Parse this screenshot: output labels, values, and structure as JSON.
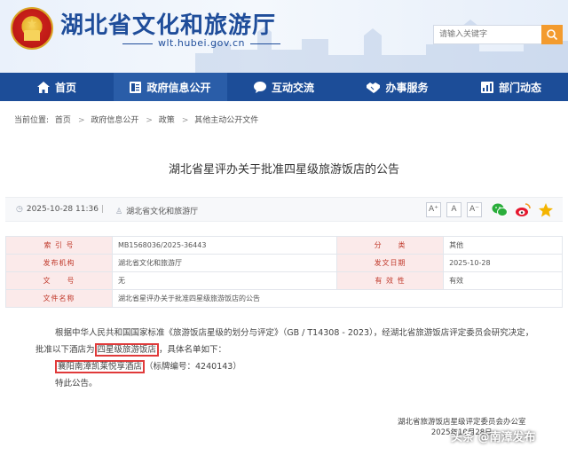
{
  "header": {
    "site_title": "湖北省文化和旅游厅",
    "site_url": "wlt.hubei.gov.cn",
    "search_placeholder": "请输入关键字"
  },
  "nav": [
    {
      "label": "首页",
      "icon": "home-icon"
    },
    {
      "label": "政府信息公开",
      "icon": "document-icon",
      "active": true
    },
    {
      "label": "互动交流",
      "icon": "chat-icon"
    },
    {
      "label": "办事服务",
      "icon": "handshake-icon"
    },
    {
      "label": "部门动态",
      "icon": "chart-icon"
    }
  ],
  "breadcrumb": {
    "prefix": "当前位置:",
    "items": [
      "首页",
      "政府信息公开",
      "政策",
      "其他主动公开文件"
    ]
  },
  "article": {
    "title": "湖北省星评办关于批准四星级旅游饭店的公告",
    "date": "2025-10-28 11:36",
    "divider": "|",
    "source": "湖北省文化和旅游厅",
    "font_buttons": [
      "A⁺",
      "A",
      "A⁻"
    ]
  },
  "info": {
    "rows": [
      {
        "k1": "索 引 号",
        "v1": "MB1568036/2025-36443",
        "k2": "分　　类",
        "v2": "其他"
      },
      {
        "k1": "发布机构",
        "v1": "湖北省文化和旅游厅",
        "k2": "发文日期",
        "v2": "2025-10-28"
      },
      {
        "k1": "文　　号",
        "v1": "无",
        "k2": "有 效 性",
        "v2": "有效"
      }
    ],
    "name_label": "文件名称",
    "name_value": "湖北省星评办关于批准四星级旅游饭店的公告"
  },
  "body": {
    "p1_a": "根据中华人民共和国国家标准《旅游饭店星级的划分与评定》（GB / T14308 - 2023），经湖北省旅游饭店评定委员会研究决定，批准以下酒店为",
    "p1_highlight": "四星级旅游饭店",
    "p1_b": "，具体名单如下：",
    "hotel": "襄阳南漳凯莱悦享酒店",
    "hotel_code": "（标牌编号：4240143）",
    "closing": "特此公告。"
  },
  "signature": {
    "org": "湖北省旅游饭店星级评定委员会办公室",
    "date": "2025年10月28日"
  },
  "watermark": "头条 @南漳发布",
  "colors": {
    "nav_bg": "#1c4d98",
    "title_blue": "#1f4d9a",
    "label_red": "#c0392b",
    "highlight_border": "#e03a3a",
    "search_btn": "#f39b2e"
  }
}
